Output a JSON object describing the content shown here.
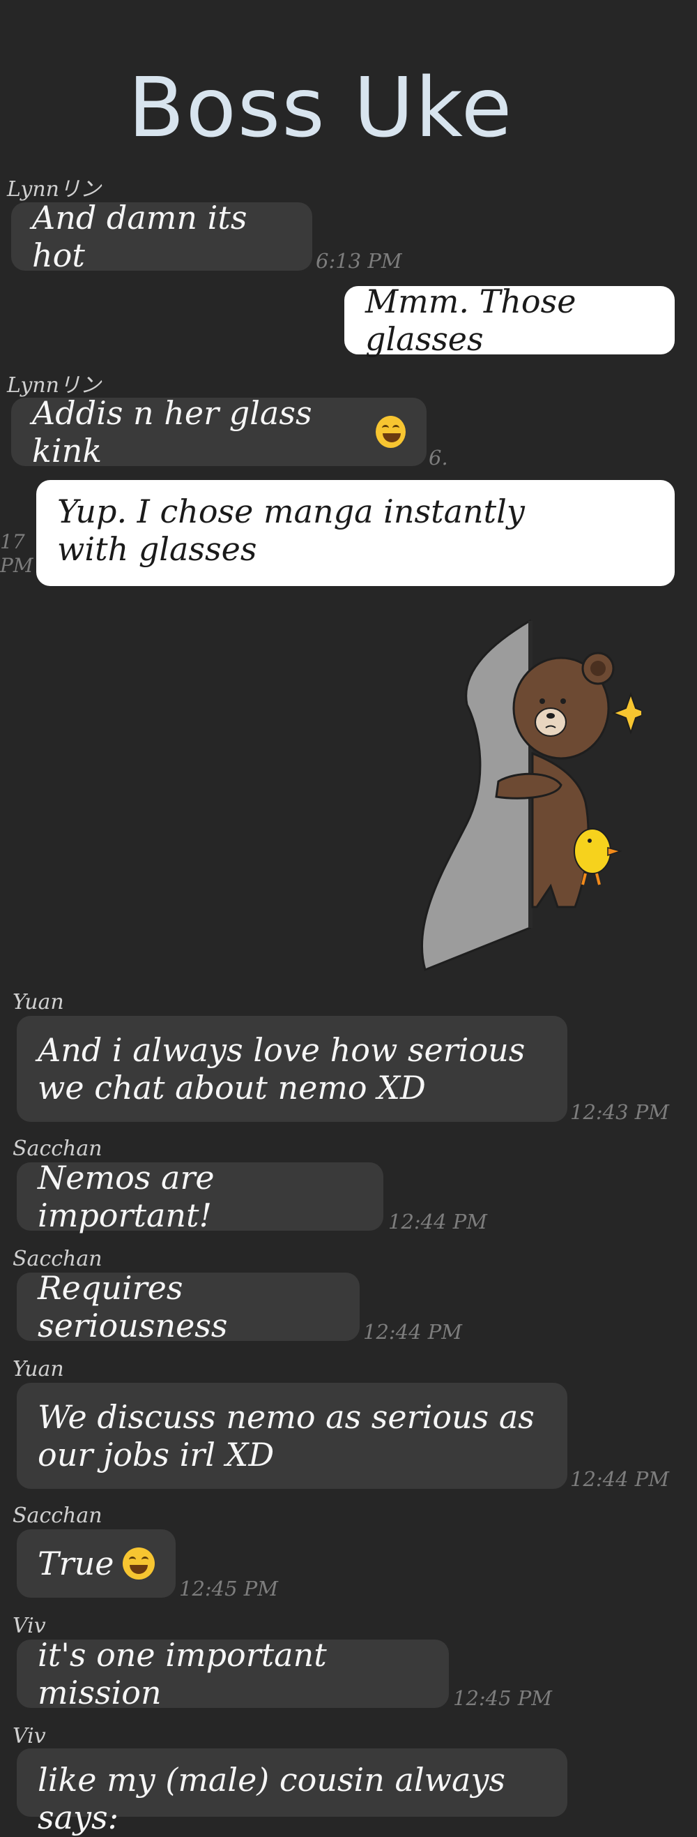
{
  "header": {
    "title": "Boss Uke"
  },
  "messages": [
    {
      "sender": "Lynnリン",
      "text": "And damn its hot",
      "time": "6:13 PM",
      "direction": "incoming"
    },
    {
      "sender": "",
      "text": "Mmm. Those glasses",
      "time": "",
      "direction": "outgoing"
    },
    {
      "sender": "Lynnリン",
      "text": "Addis n her glass kink",
      "time": "6.",
      "direction": "incoming",
      "emoji": "grinning-sweat-face"
    },
    {
      "sender": "",
      "text": "Yup. I chose manga instantly with glasses",
      "time": "17 PM",
      "direction": "outgoing"
    },
    {
      "sender": "",
      "text": "",
      "time": "",
      "direction": "outgoing",
      "sticker": "brown-bear-hiding-behind-door-with-duck"
    },
    {
      "sender": "Yuan",
      "text": "And i always love how serious we chat about nemo XD",
      "time": "12:43 PM",
      "direction": "incoming"
    },
    {
      "sender": "Sacchan",
      "text": "Nemos are important!",
      "time": "12:44 PM",
      "direction": "incoming"
    },
    {
      "sender": "Sacchan",
      "text": "Requires seriousness",
      "time": "12:44 PM",
      "direction": "incoming"
    },
    {
      "sender": "Yuan",
      "text": "We discuss nemo as serious as our jobs irl XD",
      "time": "12:44 PM",
      "direction": "incoming"
    },
    {
      "sender": "Sacchan",
      "text": "True",
      "time": "12:45 PM",
      "direction": "incoming",
      "emoji": "tears-of-joy-face"
    },
    {
      "sender": "Viv",
      "text": "it's one important mission",
      "time": "12:45 PM",
      "direction": "incoming"
    },
    {
      "sender": "Viv",
      "text": "like my (male) cousin always says:",
      "time": "",
      "direction": "incoming"
    }
  ],
  "colors": {
    "background": "#262626",
    "incoming_bubble": "#3a3a3a",
    "outgoing_bubble": "#ffffff",
    "timestamp": "#7d7d7d",
    "title": "#d8e4ee"
  }
}
